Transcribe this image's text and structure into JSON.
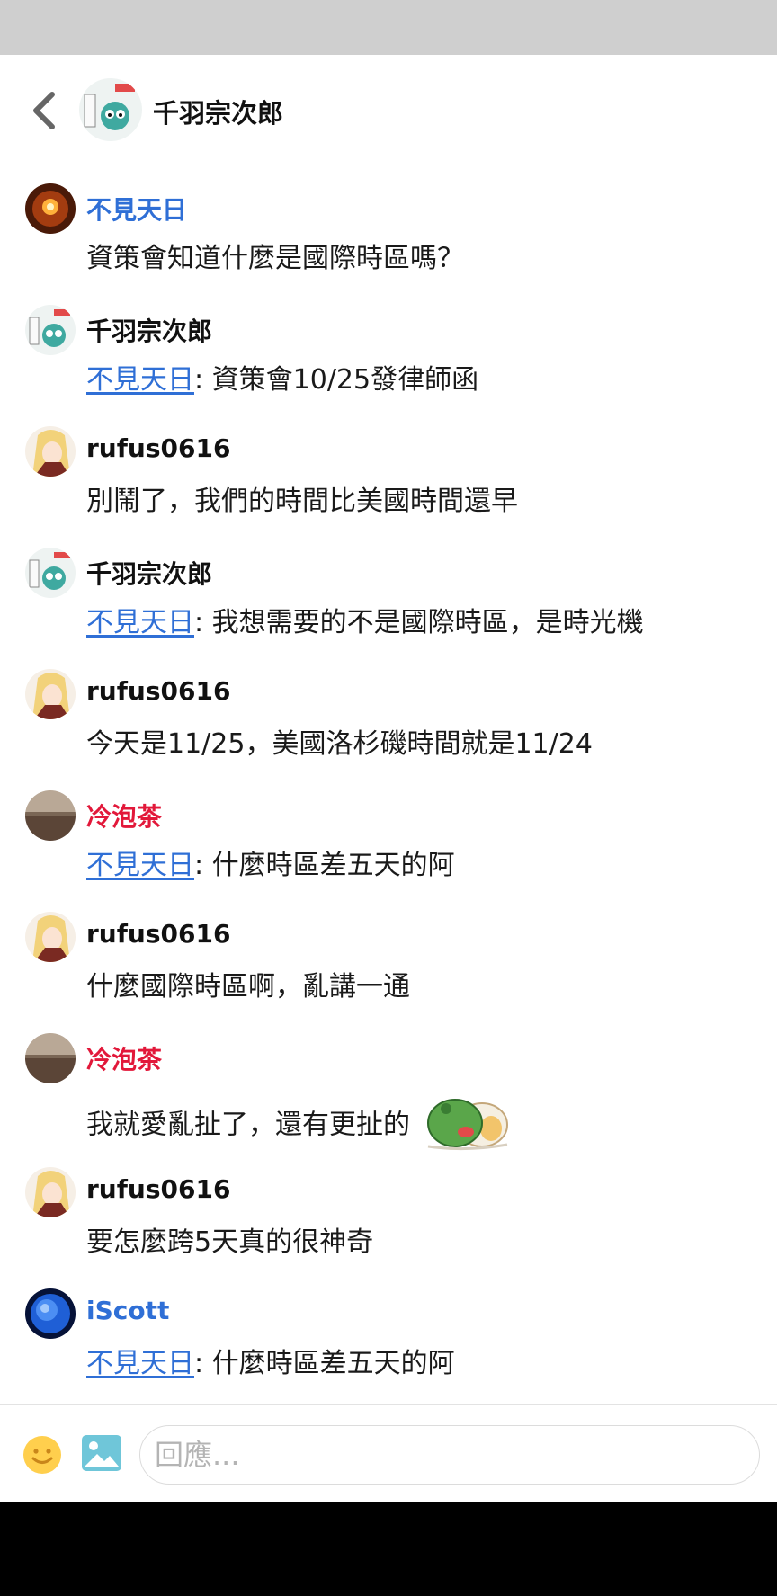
{
  "header": {
    "title": "千羽宗次郎"
  },
  "messages": [
    {
      "user": "不見天日",
      "name_color": "blue",
      "avatar": "lamp-avatar",
      "text": "資策會知道什麼是國際時區嗎？"
    },
    {
      "user": "千羽宗次郎",
      "name_color": "black",
      "avatar": "cartoon-avatar",
      "mention": "不見天日",
      "text": ": 資策會10/25發律師函"
    },
    {
      "user": "rufus0616",
      "name_color": "black",
      "avatar": "anime-girl-avatar",
      "text": "別鬧了，我們的時間比美國時間還早"
    },
    {
      "user": "千羽宗次郎",
      "name_color": "black",
      "avatar": "cartoon-avatar",
      "mention": "不見天日",
      "text": ": 我想需要的不是國際時區，是時光機"
    },
    {
      "user": "rufus0616",
      "name_color": "black",
      "avatar": "anime-girl-avatar",
      "text": "今天是11/25，美國洛杉磯時間就是11/24"
    },
    {
      "user": "冷泡茶",
      "name_color": "red",
      "avatar": "landscape-avatar",
      "mention": "不見天日",
      "text": ": 什麼時區差五天的阿"
    },
    {
      "user": "rufus0616",
      "name_color": "black",
      "avatar": "anime-girl-avatar",
      "text": "什麼國際時區啊，亂講一通"
    },
    {
      "user": "冷泡茶",
      "name_color": "red",
      "avatar": "landscape-avatar",
      "text": "我就愛亂扯了，還有更扯的",
      "sticker": "frog-sticker"
    },
    {
      "user": "rufus0616",
      "name_color": "black",
      "avatar": "anime-girl-avatar",
      "text": "要怎麼跨5天真的很神奇"
    },
    {
      "user": "iScott",
      "name_color": "blue",
      "avatar": "planet-avatar",
      "mention": "不見天日",
      "text": ": 什麼時區差五天的阿"
    }
  ],
  "composer": {
    "placeholder": "回應..."
  },
  "colors": {
    "blue_name": "#2f6fd6",
    "red_name": "#e2183a",
    "status_bar": "#cfcfcf",
    "nav_bar": "#000000"
  }
}
